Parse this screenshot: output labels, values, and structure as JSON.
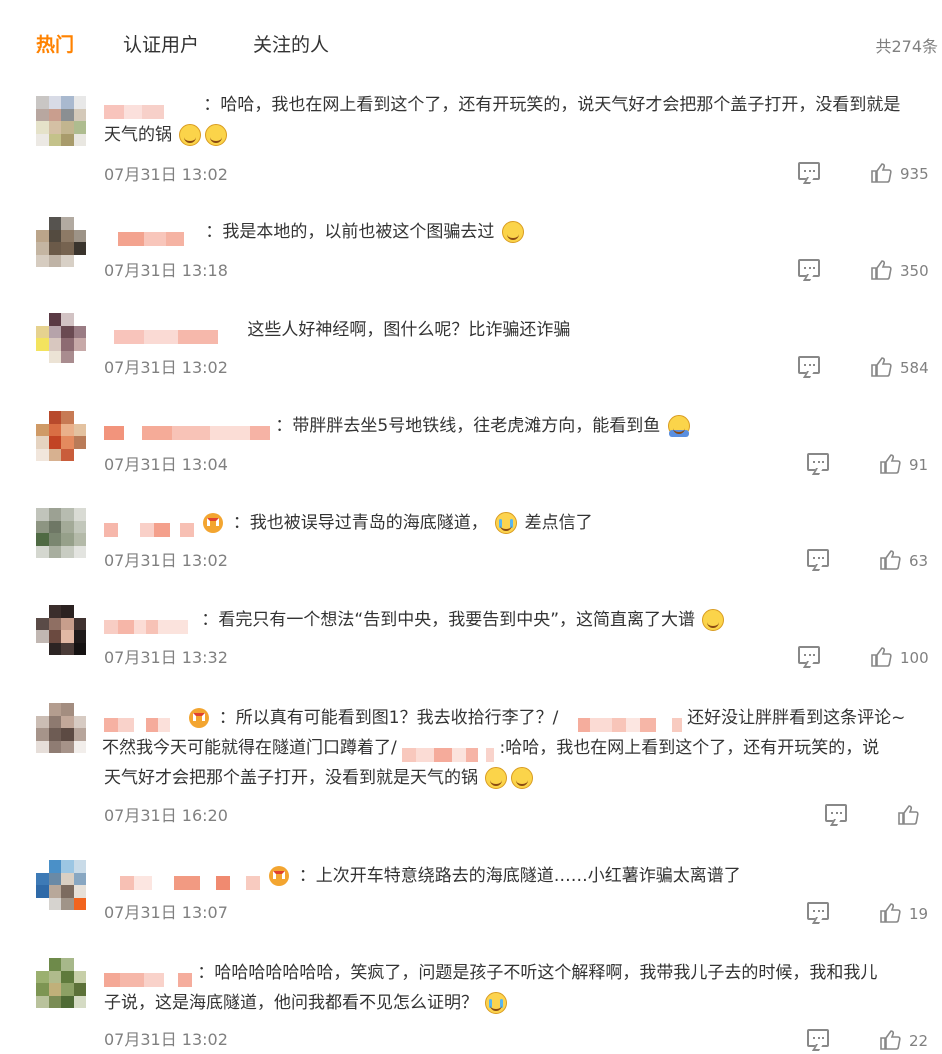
{
  "tabs": {
    "hot": "热门",
    "verified": "认证用户",
    "following": "关注的人",
    "count": "共274条"
  },
  "comments": [
    {
      "text1": "：哈哈，我也在网上看到这个了，还有开玩笑的，说天气好才会把那个盖子打开，没看到就是",
      "text2": "天气的锅",
      "time": "07月31日 13:02",
      "likes": "935"
    },
    {
      "text1": "：我是本地的，以前也被这个图骗去过",
      "time": "07月31日 13:18",
      "likes": "350"
    },
    {
      "text1": "这些人好神经啊，图什么呢？比诈骗还诈骗",
      "time": "07月31日 13:02",
      "likes": "584"
    },
    {
      "text1": "：带胖胖去坐5号地铁线，往老虎滩方向，能看到鱼",
      "time": "07月31日 13:04",
      "likes": "91"
    },
    {
      "text1": "：我也被误导过青岛的海底隧道，",
      "text1b": "差点信了",
      "time": "07月31日 13:02",
      "likes": "63"
    },
    {
      "text1": "：看完只有一个想法“告到中央，我要告到中央”，这简直离了大谱",
      "time": "07月31日 13:32",
      "likes": "100"
    },
    {
      "text1": "：所以真有可能看到图1？我去收拾行李了？/",
      "text1b": "还好没让胖胖看到这条评论~",
      "text2": "不然我今天可能就得在隧道门口蹲着了/",
      "text2b": ":哈哈，我也在网上看到这个了，还有开玩笑的，说",
      "text3": "天气好才会把那个盖子打开，没看到就是天气的锅",
      "time": "07月31日 16:20",
      "likes": ""
    },
    {
      "text1": "：上次开车特意绕路去的海底隧道……小红薯诈骗太离谱了",
      "time": "07月31日 13:07",
      "likes": "19"
    },
    {
      "text1": "：哈哈哈哈哈哈哈，笑疯了，问题是孩子不听这个解释啊，我带我儿子去的时候，我和我儿",
      "text2": "子说，这是海底隧道，他问我都看不见怎么证明？",
      "time": "07月31日 13:02",
      "likes": "22"
    }
  ]
}
